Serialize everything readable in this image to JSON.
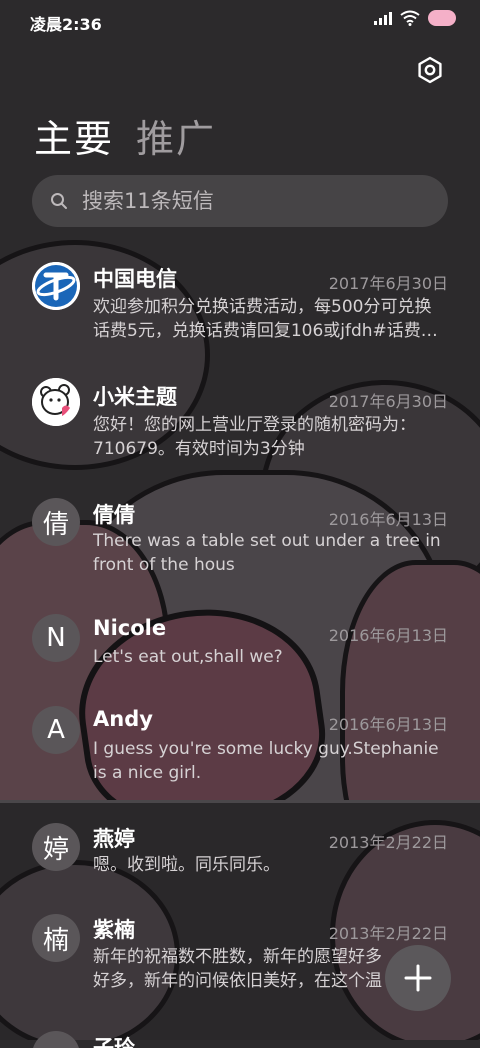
{
  "status_bar": {
    "time": "凌晨2:36"
  },
  "tabs": [
    {
      "label": "主要"
    },
    {
      "label": "推广"
    }
  ],
  "search": {
    "placeholder": "搜索11条短信"
  },
  "messages": [
    {
      "sender": "中国电信",
      "date": "2017年6月30日",
      "preview": "欢迎参加积分兑换话费活动，每500分可兑换话费5元，兑换话费请回复106或jfdh#话费…",
      "avatar": "telecom-logo"
    },
    {
      "sender": "小米主题",
      "date": "2017年6月30日",
      "preview": "您好！您的网上营业厅登录的随机密码为：710679。有效时间为3分钟",
      "avatar": "bear-logo"
    },
    {
      "sender": "倩倩",
      "date": "2016年6月13日",
      "preview": "There was a table set out under a tree in front of the hous",
      "avatar_char": "倩"
    },
    {
      "sender": "Nicole",
      "date": "2016年6月13日",
      "preview": "Let's eat out,shall we?",
      "avatar_char": "N"
    },
    {
      "sender": "Andy",
      "date": "2016年6月13日",
      "preview": "I guess you're some lucky guy.Stephanie is a nice girl.",
      "avatar_char": "A"
    },
    {
      "sender": "燕婷",
      "date": "2013年2月22日",
      "preview": "嗯。收到啦。同乐同乐。",
      "avatar_char": "婷"
    },
    {
      "sender": "紫楠",
      "date": "2013年2月22日",
      "preview": "新年的祝福数不胜数，新年的愿望好多好多，新年的问候依旧美好，在这个温馨的时刻",
      "avatar_char": "楠"
    },
    {
      "sender": "子玲",
      "date": "",
      "preview": "",
      "avatar_char": ""
    }
  ],
  "colors": {
    "background": "#2c2a2c",
    "accent_battery": "#f5b0c8"
  }
}
